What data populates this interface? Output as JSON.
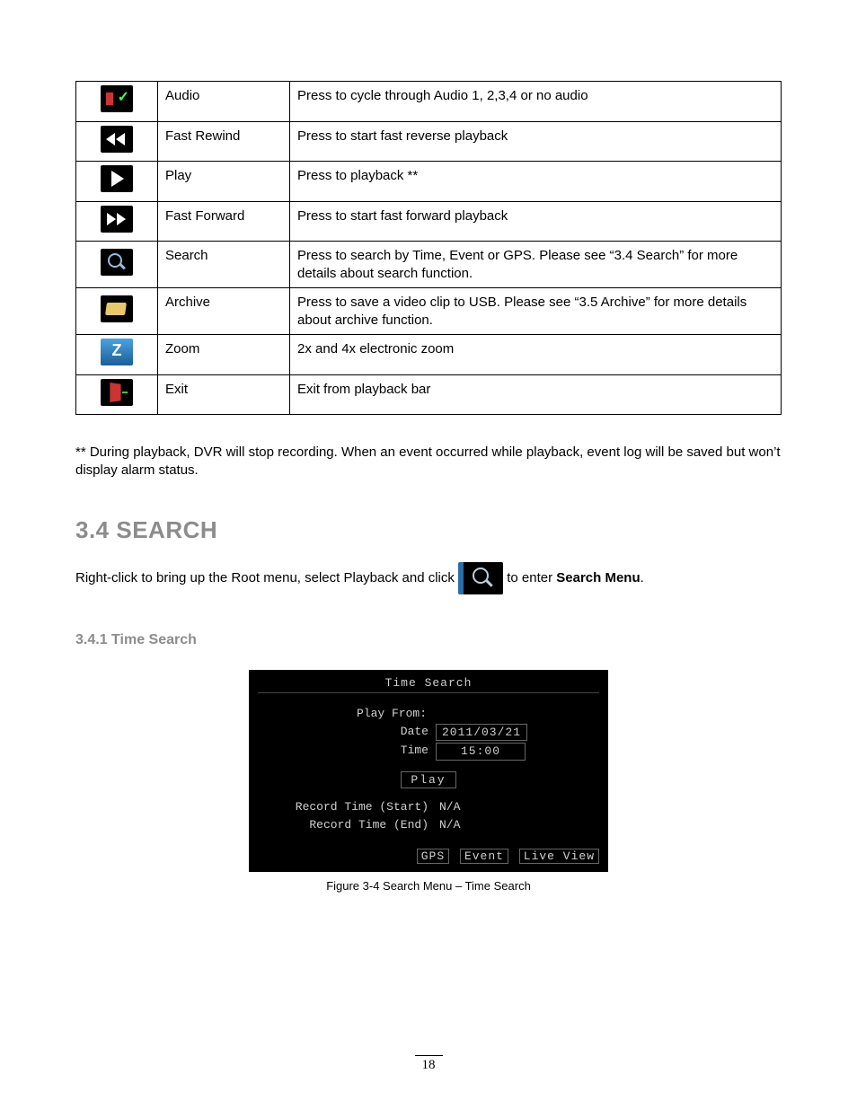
{
  "table": {
    "rows": [
      {
        "icon": "audio-icon",
        "name": "Audio",
        "desc": "Press to cycle through Audio 1, 2,3,4 or no audio"
      },
      {
        "icon": "fast-rewind-icon",
        "name": "Fast Rewind",
        "desc": "Press to start fast reverse playback"
      },
      {
        "icon": "play-icon",
        "name": "Play",
        "desc": "Press to playback  **"
      },
      {
        "icon": "fast-forward-icon",
        "name": "Fast Forward",
        "desc": "Press to start fast forward playback"
      },
      {
        "icon": "search-icon",
        "name": "Search",
        "desc": "Press to search by Time, Event or GPS. Please see “3.4 Search” for more details about search function."
      },
      {
        "icon": "archive-icon",
        "name": "Archive",
        "desc": "Press to save a video clip to USB. Please see “3.5 Archive” for more details about archive function."
      },
      {
        "icon": "zoom-icon",
        "name": "Zoom",
        "desc": "2x and 4x electronic zoom"
      },
      {
        "icon": "exit-icon",
        "name": "Exit",
        "desc": "Exit from playback bar"
      }
    ]
  },
  "note": "** During playback, DVR will stop recording. When an event occurred while playback, event log will be saved but won’t display alarm status.",
  "section": {
    "heading": "3.4  SEARCH",
    "para_pre": "Right-click to bring up the Root menu, select Playback and click ",
    "para_post": " to enter ",
    "para_bold": "Search Menu",
    "para_end": "."
  },
  "subsection": {
    "heading": "3.4.1  Time Search"
  },
  "osd": {
    "title": "Time Search",
    "playfrom": "Play From:",
    "date_label": "Date",
    "date_value": "2011/03/21",
    "time_label": "Time",
    "time_value": "15:00",
    "play_btn": "Play",
    "rec_start_label": "Record Time (Start)",
    "rec_start_value": "N/A",
    "rec_end_label": "Record Time (End)",
    "rec_end_value": "N/A",
    "foot_gps": "GPS",
    "foot_event": "Event",
    "foot_live": "Live View"
  },
  "caption": "Figure 3-4 Search Menu – Time Search",
  "page_number": "18"
}
